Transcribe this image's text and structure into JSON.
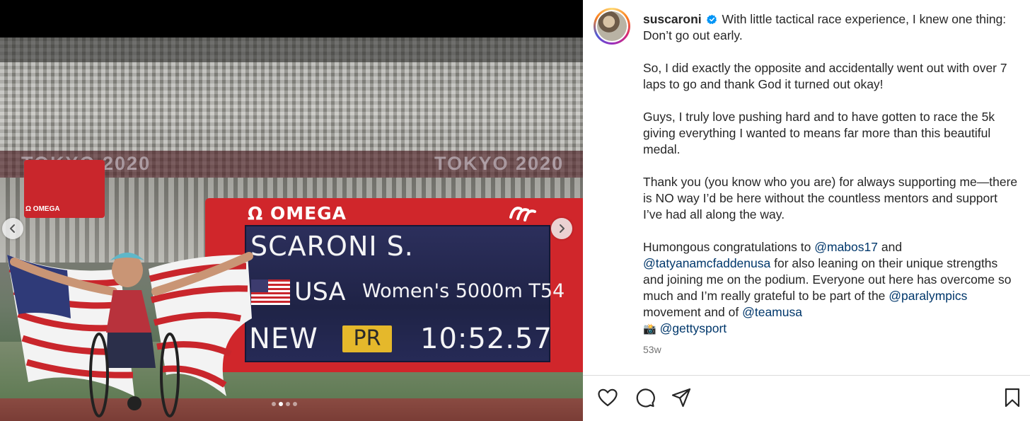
{
  "media": {
    "banner_left": "TOKYO 2020",
    "banner_right": "TOKYO 2020",
    "sign_label": "Ω OMEGA",
    "scoreboard": {
      "brand": "Ω OMEGA",
      "name": "SCARONI S.",
      "country": "USA",
      "event": "Women's 5000m T54",
      "status": "NEW",
      "badge": "PR",
      "time": "10:52.57"
    },
    "carousel": {
      "total": 4,
      "active_index": 1
    }
  },
  "post": {
    "username": "suscaroni",
    "caption_paragraphs": [
      "With little tactical race experience, I knew one thing: Don’t go out early.",
      "So, I did exactly the opposite and accidentally went out with over 7 laps to go and thank God it turned out okay!",
      "Guys, I truly love pushing hard and to have gotten to race the 5k giving everything I wanted to means far more than this beautiful medal.",
      "Thank you (you know who you are) for always supporting me—there is NO way I’d be here without the countless mentors and support I’ve had all along the way."
    ],
    "final": {
      "t1": "Humongous congratulations to ",
      "m1": "@mabos17",
      "t2": " and ",
      "m2": "@tatyanamcfaddenusa",
      "t3": " for also leaning on their unique strengths and joining me on the podium. Everyone out here has overcome so much and I’m really grateful to be part of the ",
      "m3": "@paralympics",
      "t4": " movement and of ",
      "m4": "@teamusa",
      "camera": "📸",
      "m5": "@gettysport"
    },
    "timestamp": "53w"
  },
  "colors": {
    "mention": "#00376b",
    "verified": "#0095f6",
    "scoreboard_red": "#d0262b",
    "pr_badge": "#e5b82b"
  },
  "icons": [
    "chevron-left-icon",
    "chevron-right-icon",
    "heart-icon",
    "comment-icon",
    "share-icon",
    "bookmark-icon",
    "verified-badge-icon",
    "camera-emoji"
  ]
}
